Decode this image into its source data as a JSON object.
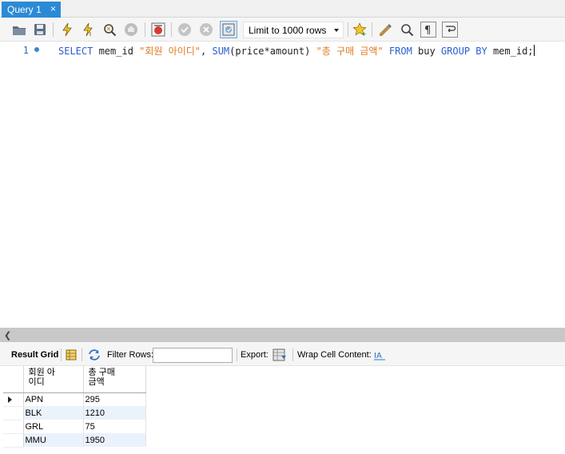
{
  "tab": {
    "title": "Query 1",
    "close": "×"
  },
  "toolbar": {
    "limit_select": "Limit to 1000 rows",
    "icons": [
      "open-folder-icon",
      "save-icon",
      "execute-icon",
      "execute-current-icon",
      "explain-icon",
      "stop-icon",
      "toggle-output-icon",
      "commit-icon",
      "rollback-icon",
      "autocommit-icon",
      "bookmark-icon",
      "beautify-icon",
      "find-icon",
      "invisible-chars-icon",
      "wrap-icon"
    ]
  },
  "editor": {
    "line_number": "1",
    "tokens": {
      "t1": "SELECT",
      "t2": " mem_id ",
      "t3": "\"회원 아이디\"",
      "t4": ", ",
      "t5": "SUM",
      "t6": "(price*amount) ",
      "t7": "\"총 구매 금액\"",
      "t8": " ",
      "t9": "FROM",
      "t10": " buy ",
      "t11": "GROUP BY",
      "t12": " mem_id;"
    }
  },
  "grid_toolbar": {
    "result_grid": "Result Grid",
    "filter_rows": "Filter Rows:",
    "filter_value": "",
    "export": "Export:",
    "wrap": "Wrap Cell Content:"
  },
  "result": {
    "columns": [
      "회원 아\n이디",
      "총 구매\n금액"
    ],
    "rows": [
      [
        "APN",
        "295"
      ],
      [
        "BLK",
        "1210"
      ],
      [
        "GRL",
        "75"
      ],
      [
        "MMU",
        "1950"
      ]
    ]
  }
}
